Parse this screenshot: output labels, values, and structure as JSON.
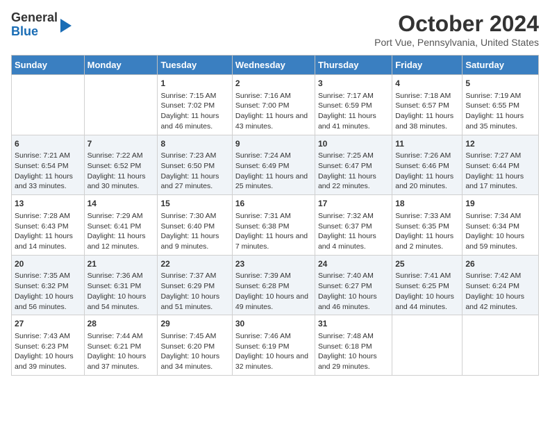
{
  "header": {
    "logo_general": "General",
    "logo_blue": "Blue",
    "title": "October 2024",
    "subtitle": "Port Vue, Pennsylvania, United States"
  },
  "days_of_week": [
    "Sunday",
    "Monday",
    "Tuesday",
    "Wednesday",
    "Thursday",
    "Friday",
    "Saturday"
  ],
  "weeks": [
    [
      {
        "day": "",
        "info": ""
      },
      {
        "day": "",
        "info": ""
      },
      {
        "day": "1",
        "info": "Sunrise: 7:15 AM\nSunset: 7:02 PM\nDaylight: 11 hours and 46 minutes."
      },
      {
        "day": "2",
        "info": "Sunrise: 7:16 AM\nSunset: 7:00 PM\nDaylight: 11 hours and 43 minutes."
      },
      {
        "day": "3",
        "info": "Sunrise: 7:17 AM\nSunset: 6:59 PM\nDaylight: 11 hours and 41 minutes."
      },
      {
        "day": "4",
        "info": "Sunrise: 7:18 AM\nSunset: 6:57 PM\nDaylight: 11 hours and 38 minutes."
      },
      {
        "day": "5",
        "info": "Sunrise: 7:19 AM\nSunset: 6:55 PM\nDaylight: 11 hours and 35 minutes."
      }
    ],
    [
      {
        "day": "6",
        "info": "Sunrise: 7:21 AM\nSunset: 6:54 PM\nDaylight: 11 hours and 33 minutes."
      },
      {
        "day": "7",
        "info": "Sunrise: 7:22 AM\nSunset: 6:52 PM\nDaylight: 11 hours and 30 minutes."
      },
      {
        "day": "8",
        "info": "Sunrise: 7:23 AM\nSunset: 6:50 PM\nDaylight: 11 hours and 27 minutes."
      },
      {
        "day": "9",
        "info": "Sunrise: 7:24 AM\nSunset: 6:49 PM\nDaylight: 11 hours and 25 minutes."
      },
      {
        "day": "10",
        "info": "Sunrise: 7:25 AM\nSunset: 6:47 PM\nDaylight: 11 hours and 22 minutes."
      },
      {
        "day": "11",
        "info": "Sunrise: 7:26 AM\nSunset: 6:46 PM\nDaylight: 11 hours and 20 minutes."
      },
      {
        "day": "12",
        "info": "Sunrise: 7:27 AM\nSunset: 6:44 PM\nDaylight: 11 hours and 17 minutes."
      }
    ],
    [
      {
        "day": "13",
        "info": "Sunrise: 7:28 AM\nSunset: 6:43 PM\nDaylight: 11 hours and 14 minutes."
      },
      {
        "day": "14",
        "info": "Sunrise: 7:29 AM\nSunset: 6:41 PM\nDaylight: 11 hours and 12 minutes."
      },
      {
        "day": "15",
        "info": "Sunrise: 7:30 AM\nSunset: 6:40 PM\nDaylight: 11 hours and 9 minutes."
      },
      {
        "day": "16",
        "info": "Sunrise: 7:31 AM\nSunset: 6:38 PM\nDaylight: 11 hours and 7 minutes."
      },
      {
        "day": "17",
        "info": "Sunrise: 7:32 AM\nSunset: 6:37 PM\nDaylight: 11 hours and 4 minutes."
      },
      {
        "day": "18",
        "info": "Sunrise: 7:33 AM\nSunset: 6:35 PM\nDaylight: 11 hours and 2 minutes."
      },
      {
        "day": "19",
        "info": "Sunrise: 7:34 AM\nSunset: 6:34 PM\nDaylight: 10 hours and 59 minutes."
      }
    ],
    [
      {
        "day": "20",
        "info": "Sunrise: 7:35 AM\nSunset: 6:32 PM\nDaylight: 10 hours and 56 minutes."
      },
      {
        "day": "21",
        "info": "Sunrise: 7:36 AM\nSunset: 6:31 PM\nDaylight: 10 hours and 54 minutes."
      },
      {
        "day": "22",
        "info": "Sunrise: 7:37 AM\nSunset: 6:29 PM\nDaylight: 10 hours and 51 minutes."
      },
      {
        "day": "23",
        "info": "Sunrise: 7:39 AM\nSunset: 6:28 PM\nDaylight: 10 hours and 49 minutes."
      },
      {
        "day": "24",
        "info": "Sunrise: 7:40 AM\nSunset: 6:27 PM\nDaylight: 10 hours and 46 minutes."
      },
      {
        "day": "25",
        "info": "Sunrise: 7:41 AM\nSunset: 6:25 PM\nDaylight: 10 hours and 44 minutes."
      },
      {
        "day": "26",
        "info": "Sunrise: 7:42 AM\nSunset: 6:24 PM\nDaylight: 10 hours and 42 minutes."
      }
    ],
    [
      {
        "day": "27",
        "info": "Sunrise: 7:43 AM\nSunset: 6:23 PM\nDaylight: 10 hours and 39 minutes."
      },
      {
        "day": "28",
        "info": "Sunrise: 7:44 AM\nSunset: 6:21 PM\nDaylight: 10 hours and 37 minutes."
      },
      {
        "day": "29",
        "info": "Sunrise: 7:45 AM\nSunset: 6:20 PM\nDaylight: 10 hours and 34 minutes."
      },
      {
        "day": "30",
        "info": "Sunrise: 7:46 AM\nSunset: 6:19 PM\nDaylight: 10 hours and 32 minutes."
      },
      {
        "day": "31",
        "info": "Sunrise: 7:48 AM\nSunset: 6:18 PM\nDaylight: 10 hours and 29 minutes."
      },
      {
        "day": "",
        "info": ""
      },
      {
        "day": "",
        "info": ""
      }
    ]
  ]
}
